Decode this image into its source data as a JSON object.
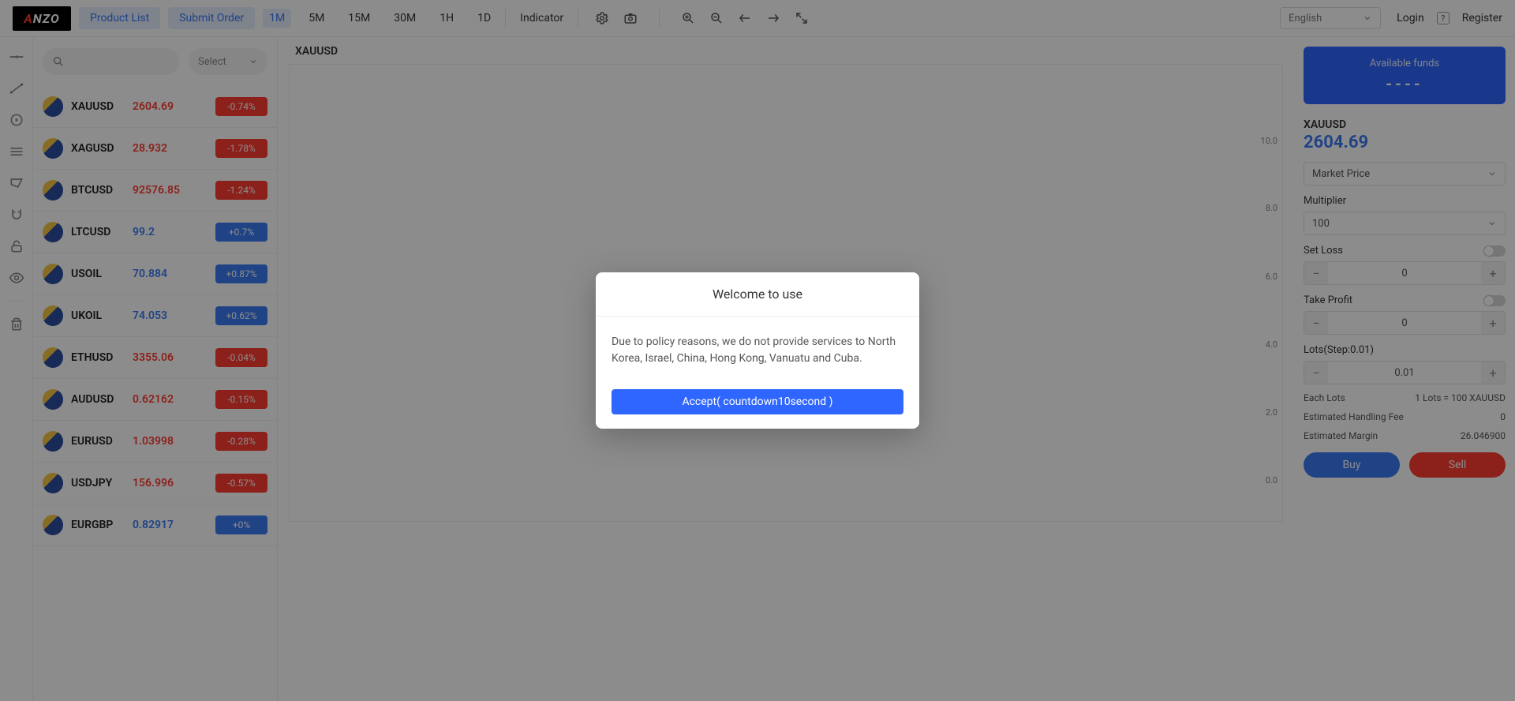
{
  "brand": {
    "text_pre": "A",
    "text_post": "NZO"
  },
  "topbar": {
    "product_list": "Product List",
    "submit_order": "Submit Order",
    "timeframes": [
      "1M",
      "5M",
      "15M",
      "30M",
      "1H",
      "1D"
    ],
    "active_tf_index": 0,
    "indicator": "Indicator",
    "language": "English",
    "login": "Login",
    "register": "Register",
    "help": "?"
  },
  "search_placeholder": "",
  "select_label": "Select",
  "products": [
    {
      "symbol": "XAUUSD",
      "price": "2604.69",
      "change": "-0.74%",
      "dir": "down"
    },
    {
      "symbol": "XAGUSD",
      "price": "28.932",
      "change": "-1.78%",
      "dir": "down"
    },
    {
      "symbol": "BTCUSD",
      "price": "92576.85",
      "change": "-1.24%",
      "dir": "down"
    },
    {
      "symbol": "LTCUSD",
      "price": "99.2",
      "change": "+0.7%",
      "dir": "up"
    },
    {
      "symbol": "USOIL",
      "price": "70.884",
      "change": "+0.87%",
      "dir": "up"
    },
    {
      "symbol": "UKOIL",
      "price": "74.053",
      "change": "+0.62%",
      "dir": "up"
    },
    {
      "symbol": "ETHUSD",
      "price": "3355.06",
      "change": "-0.04%",
      "dir": "down"
    },
    {
      "symbol": "AUDUSD",
      "price": "0.62162",
      "change": "-0.15%",
      "dir": "down"
    },
    {
      "symbol": "EURUSD",
      "price": "1.03998",
      "change": "-0.28%",
      "dir": "down"
    },
    {
      "symbol": "USDJPY",
      "price": "156.996",
      "change": "-0.57%",
      "dir": "down"
    },
    {
      "symbol": "EURGBP",
      "price": "0.82917",
      "change": "+0%",
      "dir": "up"
    }
  ],
  "chart": {
    "symbol": "XAUUSD",
    "yticks": [
      "10.0",
      "8.0",
      "6.0",
      "4.0",
      "2.0",
      "0.0"
    ]
  },
  "chart_data": {
    "type": "line",
    "title": "XAUUSD",
    "xlabel": "",
    "ylabel": "",
    "ylim": [
      0,
      10
    ],
    "series": [
      {
        "name": "XAUUSD",
        "values": []
      }
    ],
    "note": "chart area shown empty in screenshot; only y-axis ticks visible"
  },
  "order": {
    "funds_label": "Available funds",
    "funds_value": "----",
    "symbol": "XAUUSD",
    "price": "2604.69",
    "market_price": "Market Price",
    "multiplier_label": "Multiplier",
    "multiplier_value": "100",
    "set_loss_label": "Set Loss",
    "set_loss_value": "0",
    "take_profit_label": "Take Profit",
    "take_profit_value": "0",
    "lots_label": "Lots(Step:0.01)",
    "lots_value": "0.01",
    "each_lots_label": "Each Lots",
    "each_lots_value": "1 Lots = 100 XAUUSD",
    "fee_label": "Estimated Handling Fee",
    "fee_value": "0",
    "margin_label": "Estimated Margin",
    "margin_value": "26.046900",
    "buy": "Buy",
    "sell": "Sell"
  },
  "modal": {
    "title": "Welcome to use",
    "body": "Due to policy reasons, we do not provide services to North Korea, Israel, China, Hong Kong, Vanuatu and Cuba.",
    "accept": "Accept( countdown10second )"
  }
}
